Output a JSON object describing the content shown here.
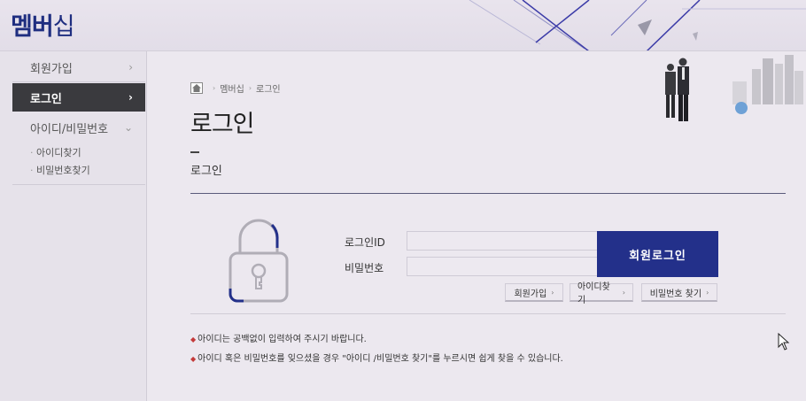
{
  "site": {
    "title_main": "멤버",
    "title_light": "십"
  },
  "sidebar": {
    "items": [
      {
        "label": "회원가입"
      },
      {
        "label": "로그인"
      },
      {
        "label": "아이디/비밀번호"
      }
    ],
    "sub_items": [
      {
        "label": "아이디찾기"
      },
      {
        "label": "비밀번호찾기"
      }
    ]
  },
  "breadcrumb": {
    "level1": "멤버십",
    "level2": "로그인"
  },
  "page": {
    "title": "로그인",
    "subtitle": "로그인"
  },
  "form": {
    "id_label": "로그인ID",
    "pw_label": "비밀번호",
    "id_value": "",
    "pw_value": "",
    "login_button": "회원로그인"
  },
  "links": [
    {
      "label": "회원가입"
    },
    {
      "label": "아이디찾기"
    },
    {
      "label": "비밀번호 찾기"
    }
  ],
  "notes": [
    "아이디는 공백없이 입력하여 주시기 바랍니다.",
    "아이디 혹은 비밀번호를 잊으셨을 경우 \"아이디 /비밀번호 찾기\"를 누르시면 쉽게 찾을 수 있습니다."
  ],
  "colors": {
    "brand": "#1f2e80",
    "button": "#23308a",
    "active_menu": "#3a3a3e",
    "note_bullet": "#c43a3a"
  }
}
